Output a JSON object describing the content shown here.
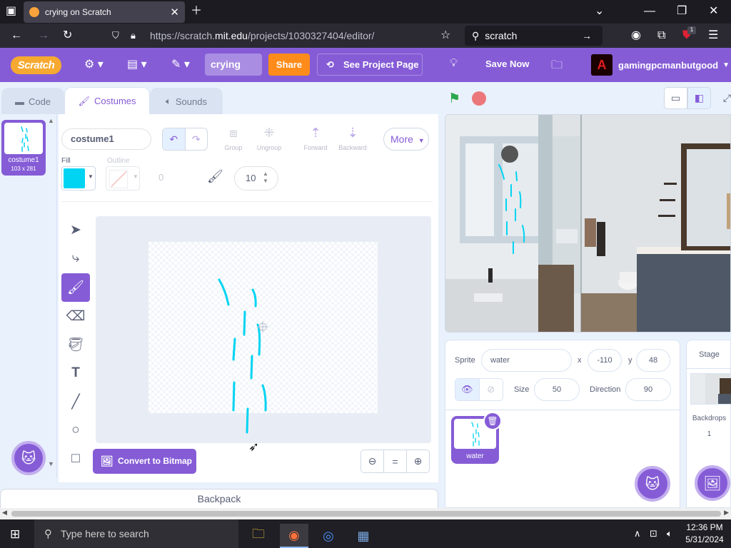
{
  "browser": {
    "tab_title": "crying on Scratch",
    "url_prefix": "https://scratch.",
    "url_domain": "mit.edu",
    "url_path": "/projects/1030327404/editor/",
    "search_text": "scratch",
    "extension_badge": "1"
  },
  "menubar": {
    "logo": "Scratch",
    "project_title": "crying",
    "share_label": "Share",
    "see_project_label": "See Project Page",
    "save_label": "Save Now",
    "username": "gamingpcmanbutgood"
  },
  "tabs": {
    "code": "Code",
    "costumes": "Costumes",
    "sounds": "Sounds"
  },
  "costume_list": [
    {
      "number": "1",
      "name": "costume1",
      "dimensions": "103 x 281"
    }
  ],
  "paint_editor": {
    "costume_name": "costume1",
    "group_label": "Group",
    "ungroup_label": "Ungroup",
    "forward_label": "Forward",
    "backward_label": "Backward",
    "more_label": "More",
    "fill_label": "Fill",
    "fill_color": "#00d4f2",
    "outline_label": "Outline",
    "outline_width": "0",
    "brush_size": "10",
    "convert_label": "Convert to Bitmap",
    "active_tool": "brush"
  },
  "backpack_label": "Backpack",
  "sprite_info": {
    "sprite_label": "Sprite",
    "sprite_name": "water",
    "x_label": "x",
    "x_value": "-110",
    "y_label": "y",
    "y_value": "48",
    "size_label": "Size",
    "size_value": "50",
    "direction_label": "Direction",
    "direction_value": "90"
  },
  "sprites": [
    {
      "name": "water"
    }
  ],
  "stage_pane": {
    "title": "Stage",
    "backdrops_label": "Backdrops",
    "backdrops_count": "1"
  },
  "taskbar": {
    "search_placeholder": "Type here to search",
    "time": "12:36 PM",
    "date": "5/31/2024"
  },
  "colors": {
    "scratch_purple": "#855cd6",
    "share_orange": "#ff8c1a",
    "water_cyan": "#00d4f2"
  }
}
